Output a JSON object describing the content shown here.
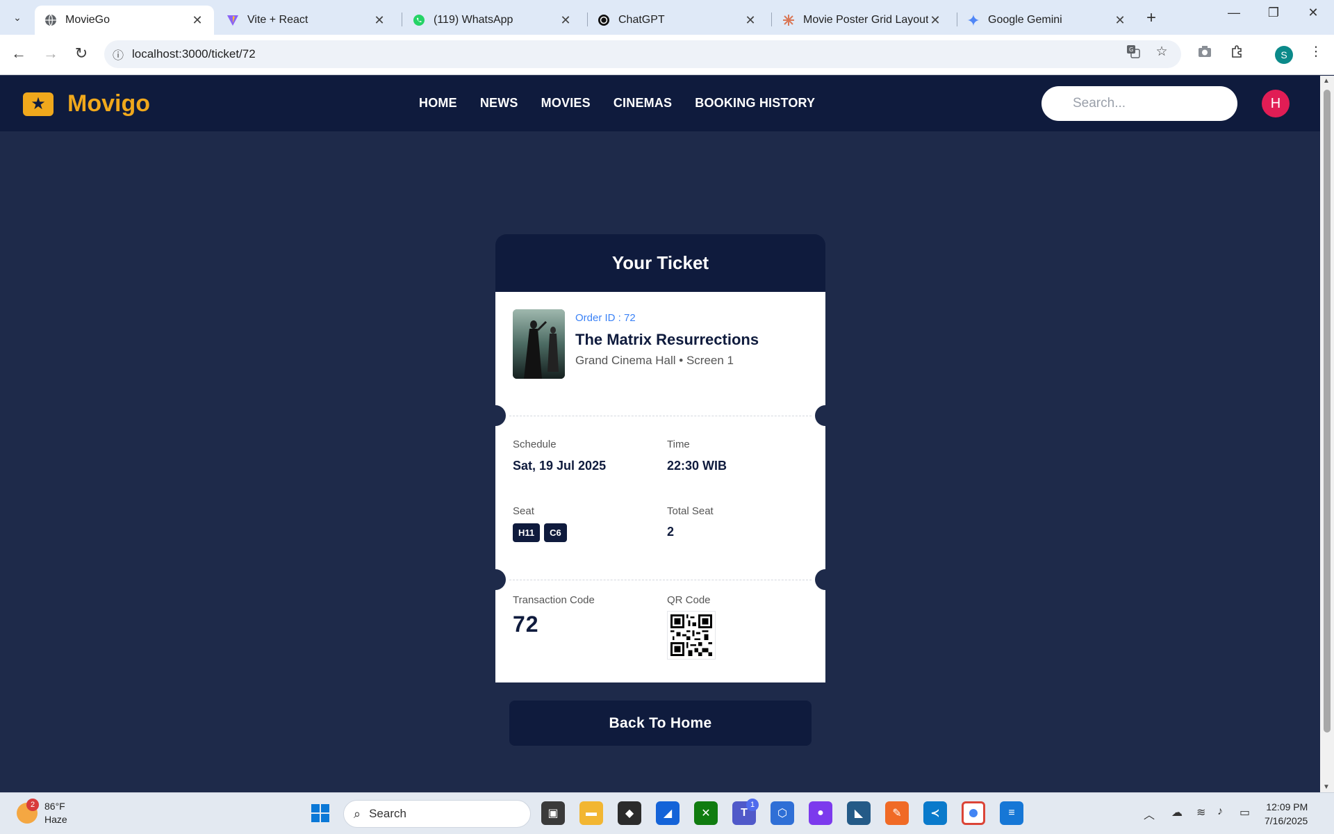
{
  "browser": {
    "tabs": [
      {
        "title": "MovieGo",
        "icon": "globe-icon",
        "active": true
      },
      {
        "title": "Vite + React",
        "icon": "vite-icon",
        "active": false
      },
      {
        "title": "(119) WhatsApp",
        "icon": "whatsapp-icon",
        "active": false
      },
      {
        "title": "ChatGPT",
        "icon": "chatgpt-icon",
        "active": false
      },
      {
        "title": "Movie Poster Grid Layout C",
        "icon": "claude-icon",
        "active": false
      },
      {
        "title": "Google Gemini",
        "icon": "gemini-icon",
        "active": false
      }
    ],
    "url": "localhost:3000/ticket/72",
    "profile_initial": "S"
  },
  "app": {
    "brand": "Movigo",
    "nav": [
      "HOME",
      "NEWS",
      "MOVIES",
      "CINEMAS",
      "BOOKING HISTORY"
    ],
    "search_placeholder": "Search...",
    "avatar_initial": "H",
    "colors": {
      "navy": "#0f1b3d",
      "background": "#1e2a4a",
      "accent": "#f0a81c",
      "avatar": "#e11d55",
      "link": "#3b82f6"
    }
  },
  "ticket": {
    "heading": "Your Ticket",
    "order_id": "Order ID : 72",
    "movie_title": "The Matrix Resurrections",
    "cinema": "Grand Cinema Hall • Screen 1",
    "schedule_label": "Schedule",
    "schedule_value": "Sat, 19 Jul 2025",
    "time_label": "Time",
    "time_value": "22:30 WIB",
    "seat_label": "Seat",
    "seats": [
      "H11",
      "C6"
    ],
    "total_seat_label": "Total Seat",
    "total_seat_value": "2",
    "transaction_label": "Transaction Code",
    "transaction_value": "72",
    "qr_label": "QR Code"
  },
  "back_button": "Back To Home",
  "taskbar": {
    "weather_temp": "86°F",
    "weather_desc": "Haze",
    "weather_badge": "2",
    "search_label": "Search",
    "teams_badge": "1",
    "time": "12:09 PM",
    "date": "7/16/2025"
  }
}
